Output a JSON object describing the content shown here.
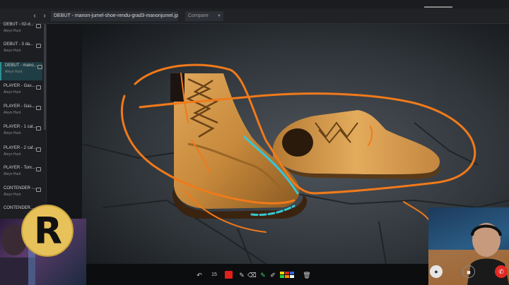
{
  "header": {
    "back_icon": "chevron-left-icon",
    "forward_icon": "chevron-right-icon",
    "filename": "DEBUT - manon-jumel-shoe-rendu-grad3-manonjumel.jpg",
    "compare_label": "Compare"
  },
  "sidebar": {
    "items": [
      {
        "title": "DEBUT - 02-d...",
        "author": "Aleyn Hunt"
      },
      {
        "title": "DEBUT - 3 da...",
        "author": "Aleyn Hunt"
      },
      {
        "title": "DEBUT - mano...",
        "author": "Aleyn Hunt",
        "active": true
      },
      {
        "title": "PLAYER - Gas...",
        "author": "Aleyn Hunt"
      },
      {
        "title": "PLAYER - Gas...",
        "author": "Aleyn Hunt"
      },
      {
        "title": "PLAYER - 1 cal...",
        "author": "Aleyn Hunt"
      },
      {
        "title": "PLAYER - 2 caf...",
        "author": "Aleyn Hunt"
      },
      {
        "title": "PLAYER - Tom...",
        "author": "Aleyn Hunt"
      },
      {
        "title": "CONTENDER -...",
        "author": "Aleyn Hunt"
      },
      {
        "title": "CONTENDER...",
        "author": ""
      }
    ]
  },
  "logo": {
    "letter": "R"
  },
  "toolbar": {
    "undo_icon": "undo-icon",
    "stroke_size": "15",
    "color": "#e0201b",
    "pen_icon": "pen-icon",
    "eraser_icon": "eraser-icon",
    "marker_icon": "marker-icon",
    "brush_icon": "brush-icon",
    "palette_icon": "palette-icon",
    "trash_icon": "trash-icon"
  },
  "call": {
    "mic_icon": "microphone-icon",
    "camera_icon": "camera-icon",
    "hangup_icon": "hangup-icon"
  },
  "annotation_colors": {
    "orange": "#f07a1a",
    "cyan": "#36c7d4"
  }
}
